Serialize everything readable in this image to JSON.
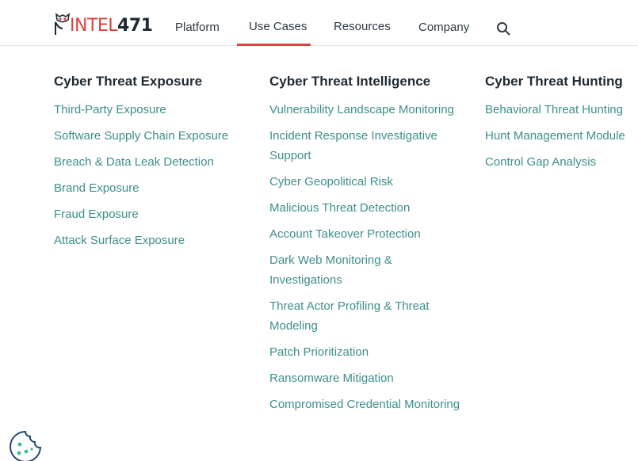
{
  "brand": {
    "logo_intel": "INTEL",
    "logo_num": "471"
  },
  "nav": {
    "items": [
      {
        "label": "Platform"
      },
      {
        "label": "Use Cases"
      },
      {
        "label": "Resources"
      },
      {
        "label": "Company"
      }
    ],
    "active": "Use Cases"
  },
  "menu": {
    "columns": [
      {
        "title": "Cyber Threat Exposure",
        "links": [
          "Third-Party Exposure",
          "Software Supply Chain Exposure",
          "Breach & Data Leak Detection",
          "Brand Exposure",
          "Fraud Exposure",
          "Attack Surface Exposure"
        ]
      },
      {
        "title": "Cyber Threat Intelligence",
        "links": [
          "Vulnerability Landscape Monitoring",
          "Incident Response Investigative Support",
          "Cyber Geopolitical Risk",
          "Malicious Threat Detection",
          "Account Takeover Protection",
          "Dark Web Monitoring & Investigations",
          "Threat Actor Profiling & Threat Modeling",
          "Patch Prioritization",
          "Ransomware Mitigation",
          "Compromised Credential Monitoring"
        ]
      },
      {
        "title": "Cyber Threat Hunting",
        "links": [
          "Behavioral Threat Hunting",
          "Hunt Management Module",
          "Control Gap Analysis"
        ]
      }
    ]
  },
  "colors": {
    "accent": "#d6463f",
    "link": "#3d8f8a",
    "text": "#1f2a33"
  },
  "icons": {
    "search": "search-icon",
    "cookie": "cookie-icon",
    "logo": "owl-logo-icon"
  }
}
